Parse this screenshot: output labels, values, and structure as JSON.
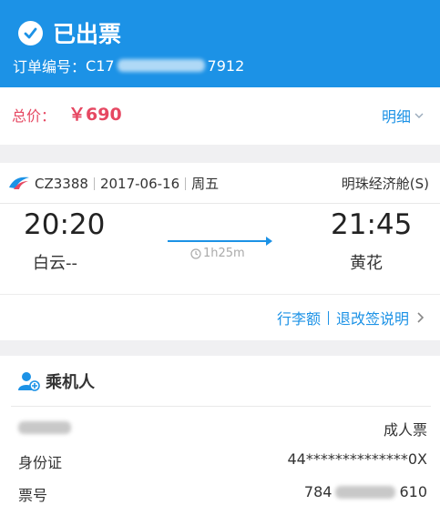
{
  "header": {
    "status": "已出票",
    "order_label": "订单编号：",
    "order_prefix": "C17",
    "order_suffix": "7912",
    "bg_color": "#1c92e6"
  },
  "price": {
    "label": "总价：",
    "value": "￥690",
    "detail_link": "明细"
  },
  "flight": {
    "airline_icon": "china-southern-logo",
    "number": "CZ3388",
    "date": "2017-06-16",
    "weekday": "周五",
    "cabin": "明珠经济舱(S)",
    "departure_time": "20:20",
    "departure_airport": "白云--",
    "arrival_time": "21:45",
    "arrival_airport": "黄花",
    "duration": "1h25m",
    "baggage_link": "行李额",
    "refund_link": "退改签说明"
  },
  "passenger": {
    "section_title": "乘机人",
    "ticket_type": "成人票",
    "id_label": "身份证",
    "id_value": "44**************0X",
    "ticket_label": "票号",
    "ticket_prefix": "784",
    "ticket_suffix": "610"
  }
}
